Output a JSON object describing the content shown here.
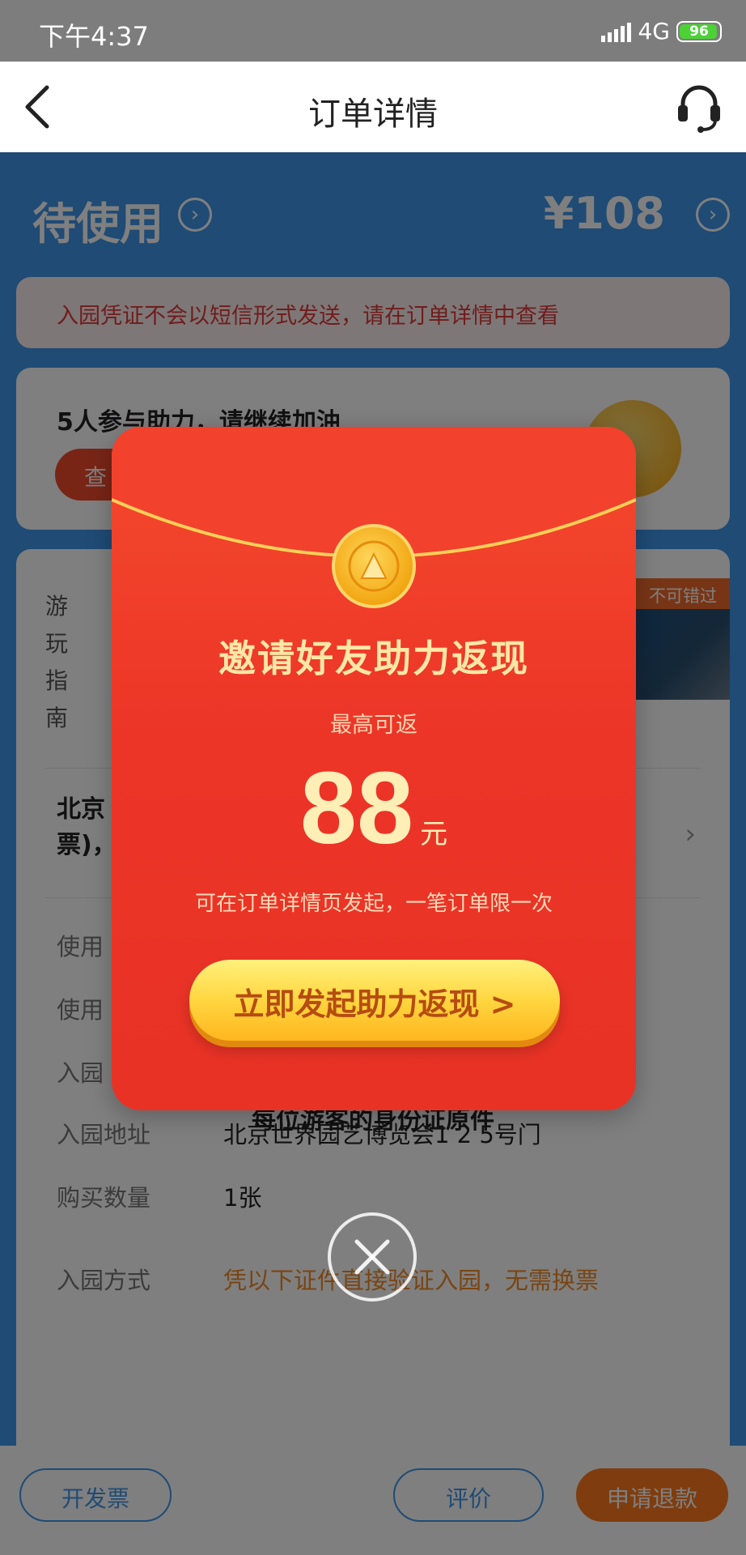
{
  "status_bar": {
    "time": "下午4:37",
    "network": "4G",
    "battery_level": "96"
  },
  "navbar": {
    "title": "订单详情",
    "back_icon": "chevron-left-icon",
    "service_icon": "headset-icon"
  },
  "order": {
    "status": "待使用",
    "price": "¥108",
    "notice": "入园凭证不会以短信形式发送，请在订单详情中查看",
    "assist_title": "5人参与助力，请继续加油",
    "assist_button_partial": "查",
    "guide_label": [
      "游",
      "玩",
      "指",
      "南"
    ],
    "banner_tag": "不可错过",
    "product_name_partial": "北京票)，",
    "rows": [
      {
        "label": "使用",
        "value": ""
      },
      {
        "label": "使用",
        "value": ""
      },
      {
        "label": "入园",
        "value": ""
      },
      {
        "label": "入园地址",
        "value": "北京世界园艺博览会1 2 5号门"
      },
      {
        "label": "购买数量",
        "value": "1张"
      },
      {
        "label": "入园方式",
        "value": "凭以下证件直接验证入园，无需换票"
      }
    ],
    "id_requirement": "每位游客的身份证原件"
  },
  "bottom_bar": {
    "invoice": "开发票",
    "review": "评价",
    "refund": "申请退款"
  },
  "popup": {
    "title": "邀请好友助力返现",
    "subtitle": "最高可返",
    "amount": "88",
    "unit": "元",
    "description": "可在订单详情页发起，一笔订单限一次",
    "cta": "立即发起助力返现 >",
    "close_icon": "close-circle-icon"
  },
  "colors": {
    "accent_blue": "#3f97ea",
    "envelope_red": "#ec3527",
    "gold": "#ffd640",
    "orange": "#f38a27"
  }
}
